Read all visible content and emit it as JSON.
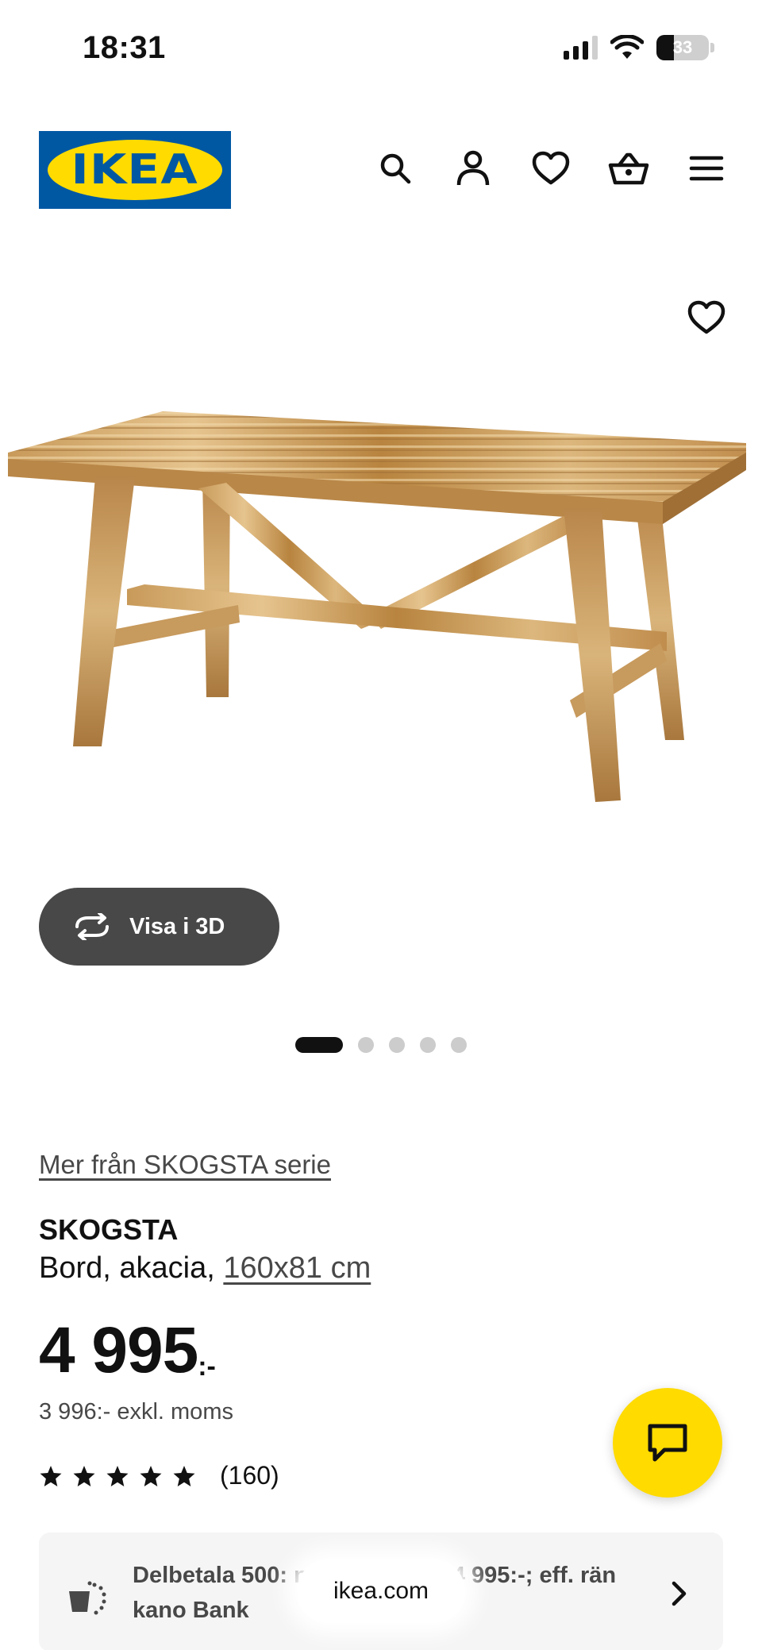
{
  "status_bar": {
    "time": "18:31",
    "battery": "33",
    "battery_level": 0.33,
    "icons": [
      "signal-icon",
      "wifi-icon",
      "battery-icon"
    ]
  },
  "header": {
    "logo_text": "IKEA",
    "icons": [
      "search-icon",
      "account-icon",
      "heart-icon",
      "basket-icon",
      "menu-icon"
    ]
  },
  "gallery": {
    "view_3d_label": "Visa i 3D",
    "image_count": 5,
    "active_index": 0
  },
  "product": {
    "series_link": "Mer från SKOGSTA serie",
    "name": "SKOGSTA",
    "description": "Bord, akacia,",
    "size": "160x81 cm",
    "price": "4 995",
    "price_suffix": ":-",
    "price_ex_vat": "3 996:- exkl. moms",
    "rating_stars": 5,
    "rating_count": "(160)"
  },
  "finance": {
    "text": "Delbetala 500: n; totalbelopp 4 995:-; eff. rän kano Bank"
  },
  "browser": {
    "url": "ikea.com"
  },
  "colors": {
    "brand_blue": "#0058a3",
    "brand_yellow": "#ffdb00",
    "button_dark": "#484848"
  }
}
